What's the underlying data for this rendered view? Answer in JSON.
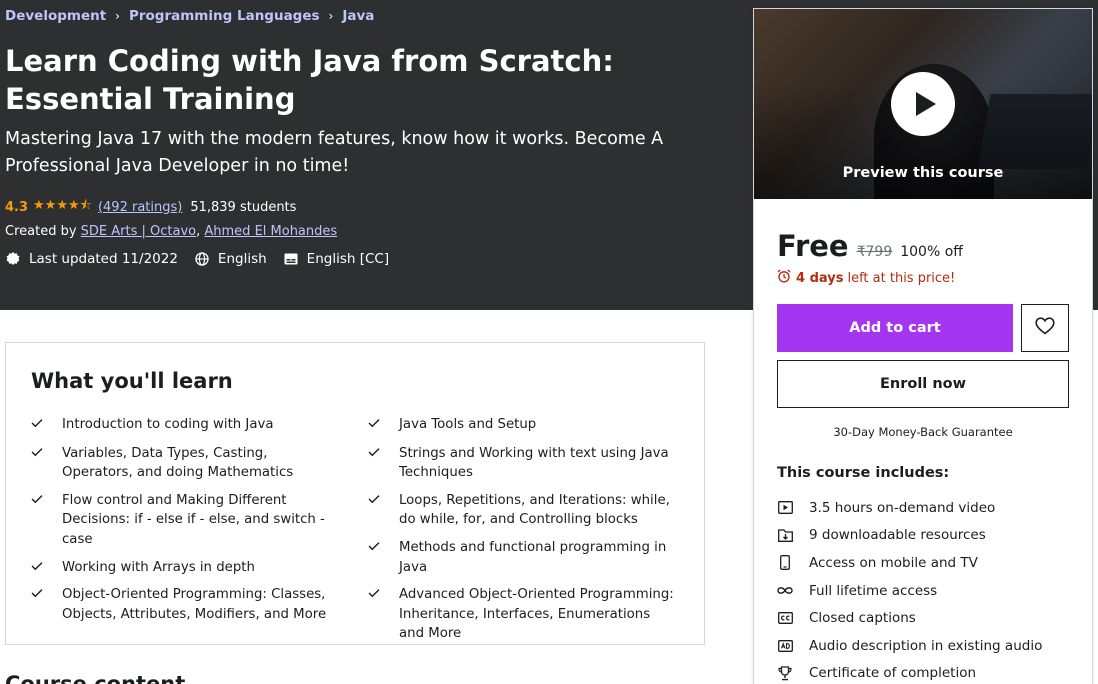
{
  "breadcrumb": [
    "Development",
    "Programming Languages",
    "Java"
  ],
  "course": {
    "title": "Learn Coding with Java from Scratch: Essential Training",
    "subtitle": "Mastering Java 17 with the modern features, know how it works. Become A Professional Java Developer in no time!",
    "rating": "4.3",
    "rating_stars": 4.3,
    "ratings_link": "(492 ratings)",
    "students": "51,839 students",
    "created_by_label": "Created by",
    "authors": [
      "SDE Arts | Octavo",
      "Ahmed El Mohandes"
    ],
    "last_updated": "Last updated 11/2022",
    "language": "English",
    "captions": "English [CC]"
  },
  "sidebar": {
    "preview_label": "Preview this course",
    "price": "Free",
    "original_price": "₹799",
    "discount": "100% off",
    "timer_days": "4 days",
    "timer_text": "left at this price!",
    "add_to_cart": "Add to cart",
    "enroll_now": "Enroll now",
    "guarantee": "30-Day Money-Back Guarantee",
    "includes_title": "This course includes:",
    "includes": [
      {
        "icon": "video-icon",
        "label": "3.5 hours on-demand video"
      },
      {
        "icon": "download-icon",
        "label": "9 downloadable resources"
      },
      {
        "icon": "mobile-icon",
        "label": "Access on mobile and TV"
      },
      {
        "icon": "infinity-icon",
        "label": "Full lifetime access"
      },
      {
        "icon": "cc-icon",
        "label": "Closed captions"
      },
      {
        "icon": "audio-description-icon",
        "label": "Audio description in existing audio"
      },
      {
        "icon": "trophy-icon",
        "label": "Certificate of completion"
      }
    ]
  },
  "learn": {
    "title": "What you'll learn",
    "left": [
      "Introduction to coding with Java",
      "Variables, Data Types, Casting, Operators, and doing Mathematics",
      "Flow control and Making Different Decisions: if - else if - else, and switch - case",
      "Working with Arrays in depth",
      "Object-Oriented Programming: Classes, Objects, Attributes, Modifiers, and More"
    ],
    "right": [
      "Java Tools and Setup",
      "Strings and Working with text using Java Techniques",
      "Loops, Repetitions, and Iterations: while, do while, for, and Controlling blocks",
      "Methods and functional programming in Java",
      "Advanced Object-Oriented Programming: Inheritance, Interfaces, Enumerations and More"
    ]
  },
  "next_section": "Course content"
}
